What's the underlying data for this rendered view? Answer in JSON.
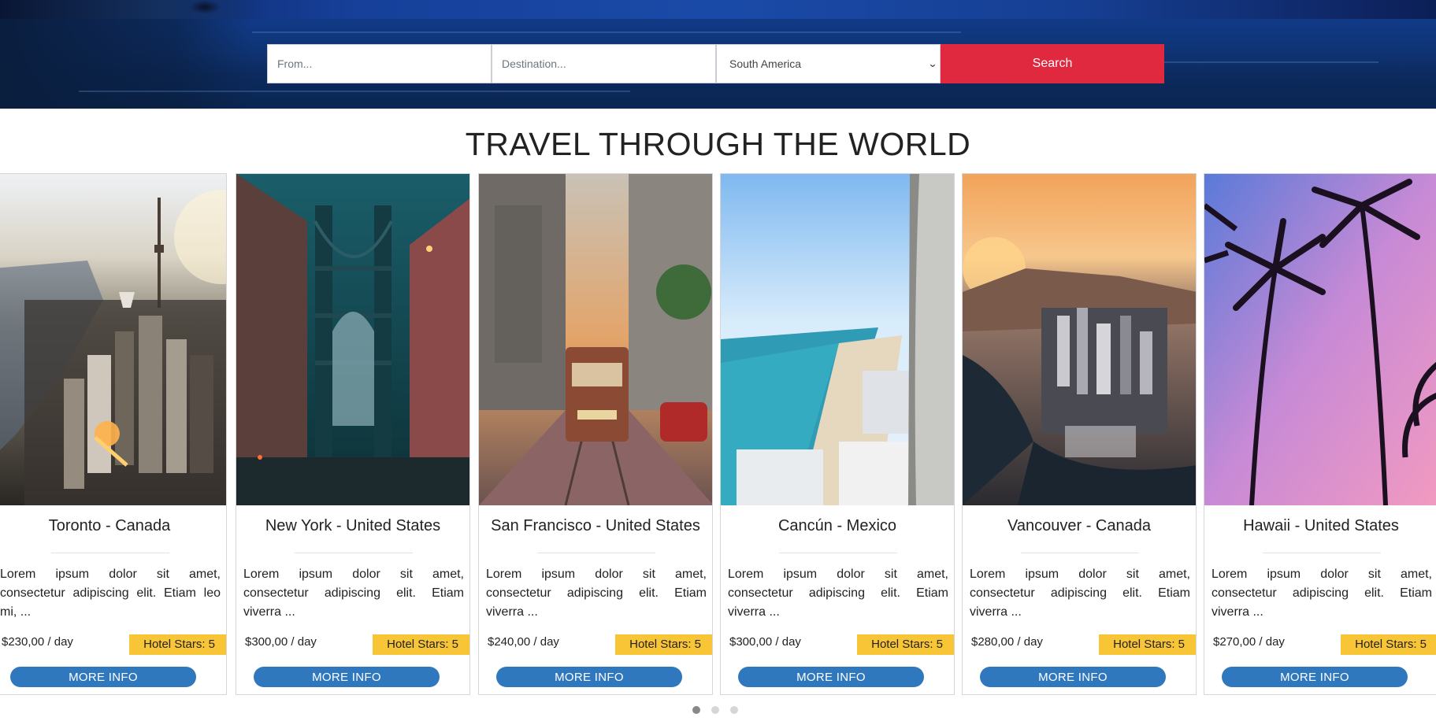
{
  "search": {
    "from_placeholder": "From...",
    "destination_placeholder": "Destination...",
    "region_selected": "South America",
    "search_label": "Search"
  },
  "heading": "TRAVEL THROUGH THE WORLD",
  "cards": [
    {
      "title": "Toronto - Canada",
      "description": "Lorem ipsum dolor sit amet, consectetur adipiscing elit. Etiam leo mi, ...",
      "price": "$230,00 / day",
      "stars": "Hotel Stars: 5",
      "more": "MORE INFO"
    },
    {
      "title": "New York - United States",
      "description": "Lorem ipsum dolor sit amet, consectetur adipiscing elit. Etiam viverra ...",
      "price": "$300,00 / day",
      "stars": "Hotel Stars: 5",
      "more": "MORE INFO"
    },
    {
      "title": "San Francisco - United States",
      "description": "Lorem ipsum dolor sit amet, consectetur adipiscing elit. Etiam viverra ...",
      "price": "$240,00 / day",
      "stars": "Hotel Stars: 5",
      "more": "MORE INFO"
    },
    {
      "title": "Cancún - Mexico",
      "description": "Lorem ipsum dolor sit amet, consectetur adipiscing elit. Etiam viverra ...",
      "price": "$300,00 / day",
      "stars": "Hotel Stars: 5",
      "more": "MORE INFO"
    },
    {
      "title": "Vancouver - Canada",
      "description": "Lorem ipsum dolor sit amet, consectetur adipiscing elit. Etiam viverra ...",
      "price": "$280,00 / day",
      "stars": "Hotel Stars: 5",
      "more": "MORE INFO"
    },
    {
      "title": "Hawaii - United States",
      "description": "Lorem ipsum dolor sit amet, consectetur adipiscing elit. Etiam viverra ...",
      "price": "$270,00 / day",
      "stars": "Hotel Stars: 5",
      "more": "MORE INFO"
    }
  ],
  "carousel": {
    "pages": 3,
    "active_page": 1
  },
  "colors": {
    "search_button": "#e0283f",
    "more_info_button": "#2f78be",
    "stars_badge": "#f8c537",
    "hero_background": "#0f3476"
  }
}
